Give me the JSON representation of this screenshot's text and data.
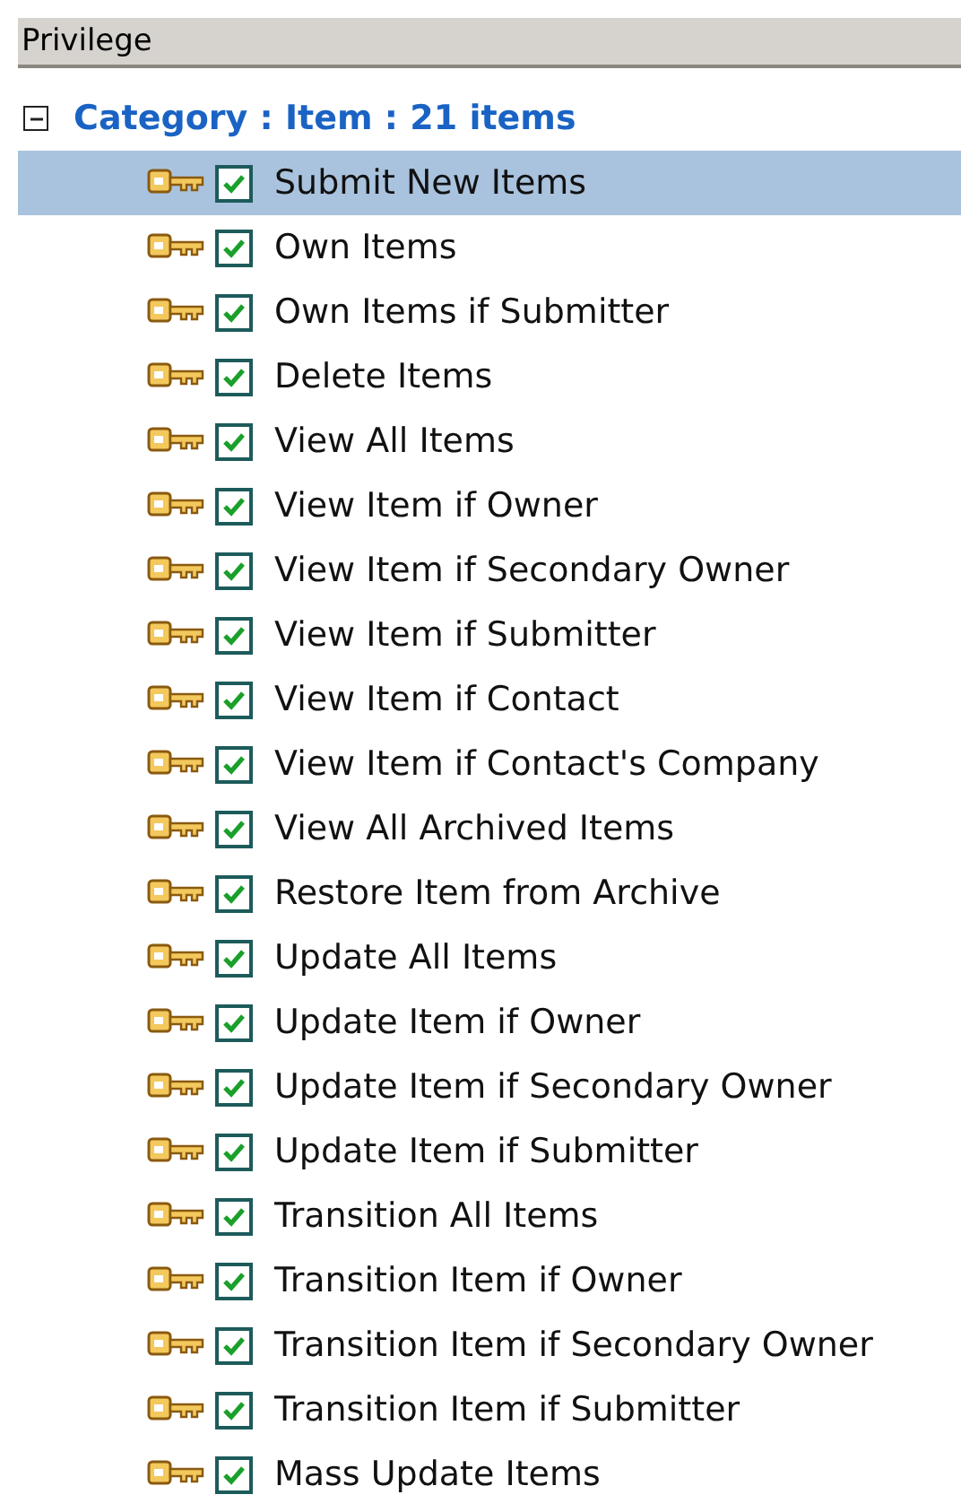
{
  "header": {
    "title": "Privilege"
  },
  "category": {
    "label": "Category : Item : 21 items",
    "expanded": true,
    "items": [
      {
        "label": "Submit New Items",
        "checked": true,
        "selected": true
      },
      {
        "label": "Own Items",
        "checked": true,
        "selected": false
      },
      {
        "label": "Own Items if Submitter",
        "checked": true,
        "selected": false
      },
      {
        "label": "Delete Items",
        "checked": true,
        "selected": false
      },
      {
        "label": "View All Items",
        "checked": true,
        "selected": false
      },
      {
        "label": "View Item if Owner",
        "checked": true,
        "selected": false
      },
      {
        "label": "View Item if Secondary Owner",
        "checked": true,
        "selected": false
      },
      {
        "label": "View Item if Submitter",
        "checked": true,
        "selected": false
      },
      {
        "label": "View Item if Contact",
        "checked": true,
        "selected": false
      },
      {
        "label": "View Item if Contact's Company",
        "checked": true,
        "selected": false
      },
      {
        "label": "View All Archived Items",
        "checked": true,
        "selected": false
      },
      {
        "label": "Restore Item from Archive",
        "checked": true,
        "selected": false
      },
      {
        "label": "Update All Items",
        "checked": true,
        "selected": false
      },
      {
        "label": "Update Item if Owner",
        "checked": true,
        "selected": false
      },
      {
        "label": "Update Item if Secondary Owner",
        "checked": true,
        "selected": false
      },
      {
        "label": "Update Item if Submitter",
        "checked": true,
        "selected": false
      },
      {
        "label": "Transition All Items",
        "checked": true,
        "selected": false
      },
      {
        "label": "Transition Item if Owner",
        "checked": true,
        "selected": false
      },
      {
        "label": "Transition Item if Secondary Owner",
        "checked": true,
        "selected": false
      },
      {
        "label": "Transition Item if Submitter",
        "checked": true,
        "selected": false
      },
      {
        "label": "Mass Update Items",
        "checked": true,
        "selected": false
      }
    ]
  }
}
